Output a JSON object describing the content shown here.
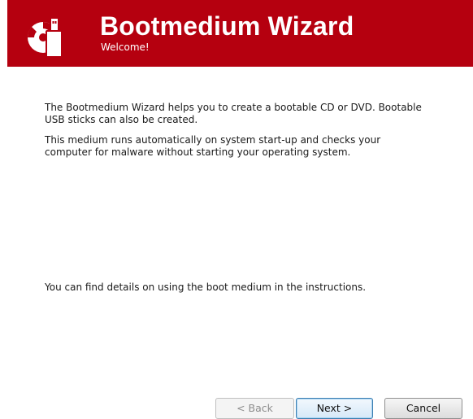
{
  "header": {
    "title": "Bootmedium Wizard",
    "subtitle": "Welcome!",
    "icon": "cd-usb-icon",
    "background_color": "#b5000f"
  },
  "body": {
    "paragraph_1": "The Bootmedium Wizard helps you to create a bootable CD or DVD. Bootable USB sticks can also be created.",
    "paragraph_2": "This medium runs automatically on system start-up and checks your computer for malware without starting your operating system.",
    "paragraph_3": "You can find details on using the boot medium in the instructions."
  },
  "buttons": {
    "back": {
      "label": "< Back",
      "enabled": false
    },
    "next": {
      "label": "Next >",
      "enabled": true,
      "default": true
    },
    "cancel": {
      "label": "Cancel",
      "enabled": true
    }
  }
}
